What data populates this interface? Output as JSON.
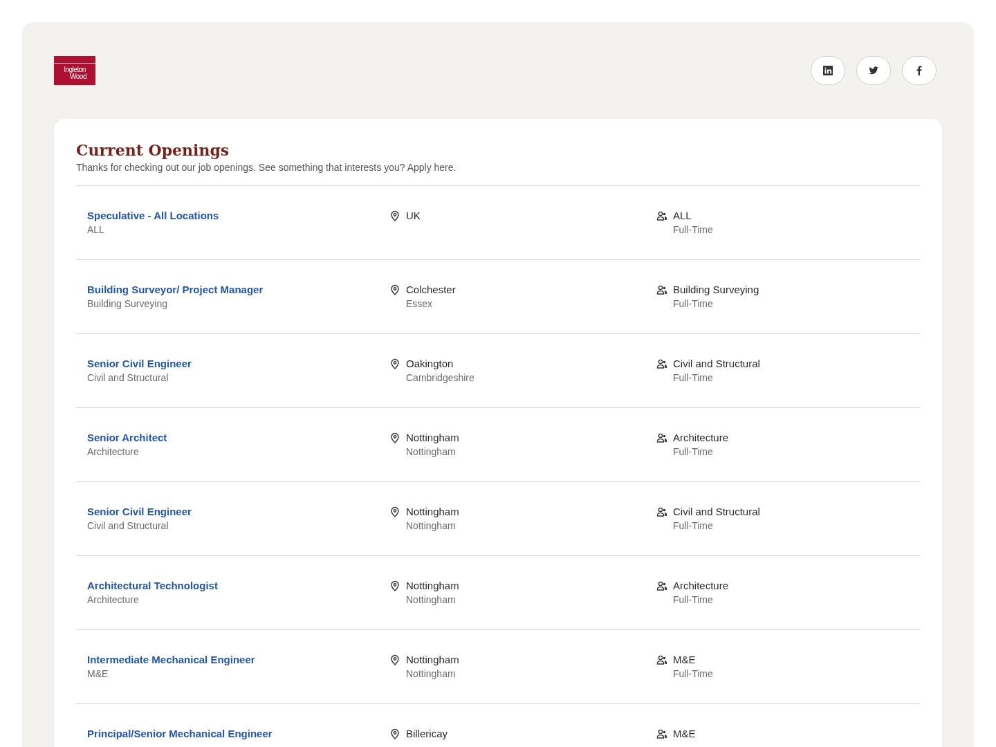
{
  "logo": {
    "lines": [
      "Ingleton",
      "Wood"
    ]
  },
  "social_links": [
    {
      "kind": "linkedin"
    },
    {
      "kind": "twitter"
    },
    {
      "kind": "facebook"
    }
  ],
  "openings": {
    "title": "Current Openings",
    "subtitle": "Thanks for checking out our job openings. See something that interests you? Apply here.",
    "jobs": [
      {
        "title": "Speculative - All Locations",
        "team": "ALL",
        "city": "UK",
        "department": "ALL",
        "type": "Full-Time"
      },
      {
        "title": "Building Surveyor/ Project Manager",
        "team": "Building Surveying",
        "city": "Colchester",
        "region": "Essex",
        "department": "Building Surveying",
        "type": "Full-Time"
      },
      {
        "title": "Senior Civil Engineer",
        "team": "Civil and Structural",
        "city": "Oakington",
        "region": "Cambridgeshire",
        "department": "Civil and Structural",
        "type": "Full-Time"
      },
      {
        "title": "Senior Architect",
        "team": "Architecture",
        "city": "Nottingham",
        "region": "Nottingham",
        "department": "Architecture",
        "type": "Full-Time"
      },
      {
        "title": "Senior Civil Engineer",
        "team": "Civil and Structural",
        "city": "Nottingham",
        "region": "Nottingham",
        "department": "Civil and Structural",
        "type": "Full-Time"
      },
      {
        "title": "Architectural Technologist",
        "team": "Architecture",
        "city": "Nottingham",
        "region": "Nottingham",
        "department": "Architecture",
        "type": "Full-Time"
      },
      {
        "title": "Intermediate Mechanical Engineer",
        "team": "M&E",
        "city": "Nottingham",
        "region": "Nottingham",
        "department": "M&E",
        "type": "Full-Time"
      },
      {
        "title": "Principal/Senior Mechanical Engineer",
        "city": "Billericay",
        "department": "M&E"
      }
    ]
  }
}
